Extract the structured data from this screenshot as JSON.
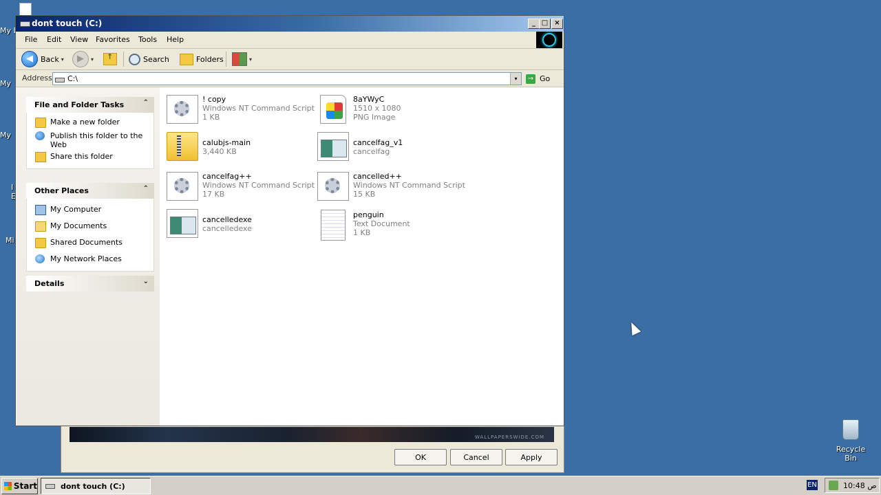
{
  "desktop": {
    "side_labels": [
      "My D",
      "My",
      "My",
      "I",
      "E",
      "Mi"
    ],
    "recycle_label": "Recycle Bin"
  },
  "window": {
    "title": "dont touch (C:)",
    "controls": {
      "minimize": "_",
      "maximize": "□",
      "close": "×"
    }
  },
  "menu": [
    "File",
    "Edit",
    "View",
    "Favorites",
    "Tools",
    "Help"
  ],
  "toolbar": {
    "back": "Back",
    "search": "Search",
    "folders": "Folders",
    "dropdown_glyph": "▾"
  },
  "address": {
    "label": "Address",
    "value": "C:\\",
    "go": "Go"
  },
  "taskpane": {
    "file_tasks": {
      "title": "File and Folder Tasks",
      "items": [
        "Make a new folder",
        "Publish this folder to the Web",
        "Share this folder"
      ]
    },
    "other_places": {
      "title": "Other Places",
      "items": [
        "My Computer",
        "My Documents",
        "Shared Documents",
        "My Network Places"
      ]
    },
    "details": {
      "title": "Details"
    },
    "collapse_glyph": "⌃",
    "expand_glyph": "⌄"
  },
  "files": [
    {
      "name": "! copy",
      "line2": "Windows NT Command Script",
      "line3": "1 KB",
      "icon": "script-icon"
    },
    {
      "name": "8aYWyC",
      "line2": "1510 x 1080",
      "line3": "PNG Image",
      "icon": "png-image-icon"
    },
    {
      "name": "calubjs-main",
      "line2": "3,440 KB",
      "line3": "",
      "icon": "zip-folder-icon"
    },
    {
      "name": "cancelfag_v1",
      "line2": "cancelfag",
      "line3": "",
      "icon": "exe-icon"
    },
    {
      "name": "cancelfag++",
      "line2": "Windows NT Command Script",
      "line3": "17 KB",
      "icon": "script-icon"
    },
    {
      "name": "cancelled++",
      "line2": "Windows NT Command Script",
      "line3": "15 KB",
      "icon": "script-icon"
    },
    {
      "name": "cancelledexe",
      "line2": "cancelledexe",
      "line3": "",
      "icon": "exe-icon"
    },
    {
      "name": "penguin",
      "line2": "Text Document",
      "line3": "1 KB",
      "icon": "text-document-icon"
    }
  ],
  "bg_dialog": {
    "ok": "OK",
    "cancel": "Cancel",
    "apply": "Apply",
    "strip_text": "WALLPAPERSWIDE.COM"
  },
  "taskbar": {
    "start": "Start",
    "task_button": "dont touch (C:)",
    "lang": "EN",
    "time": "10:48 ص"
  },
  "colors": {
    "desktop": "#3a6ea5",
    "titlebar_start": "#0a246a",
    "titlebar_end": "#a6caf0",
    "chrome": "#ece9d8"
  }
}
